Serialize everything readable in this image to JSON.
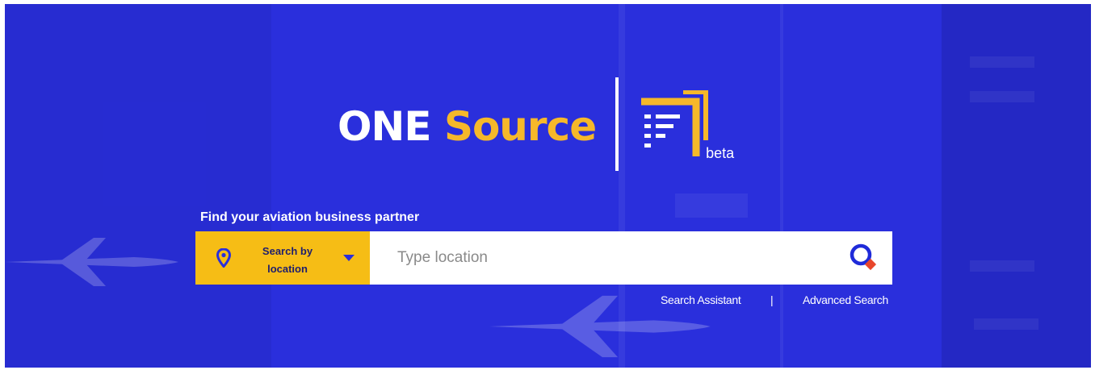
{
  "logo": {
    "part1": "ONE",
    "part2": "Source",
    "badge": "beta"
  },
  "tagline": "Find your aviation business partner",
  "search": {
    "mode_label": "Search by location",
    "placeholder": "Type location",
    "value": ""
  },
  "links": {
    "assistant": "Search Assistant",
    "separator": "|",
    "advanced": "Advanced Search"
  },
  "icons": {
    "location": "map-pin-icon",
    "dropdown": "chevron-down-icon",
    "search": "search-icon",
    "logo_mark": "list-document-icon"
  },
  "colors": {
    "background": "#2a2fdc",
    "accent": "#f6b82a",
    "button": "#f6bd15",
    "search_ring": "#1f2bd9",
    "search_dot": "#e8462b"
  }
}
